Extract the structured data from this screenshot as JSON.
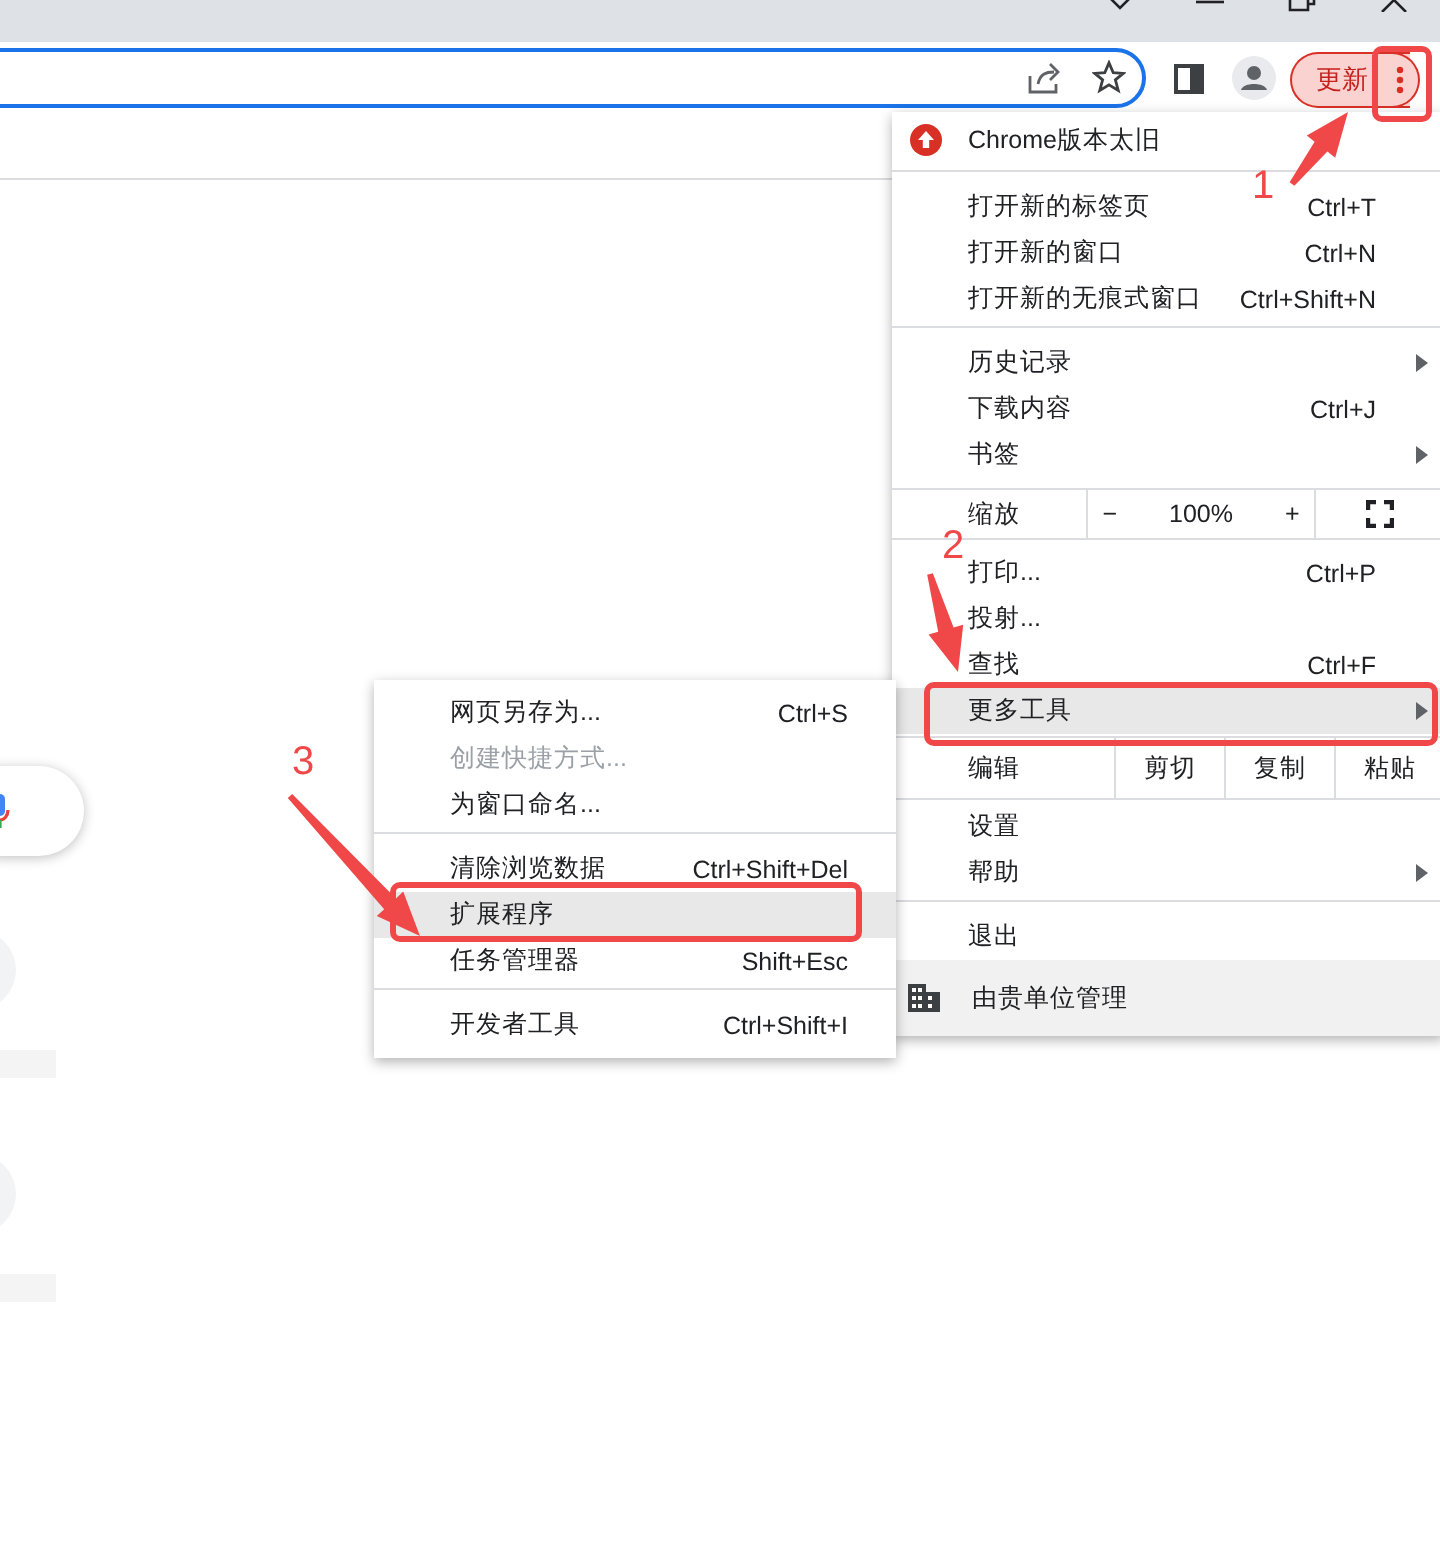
{
  "toolbar": {
    "update_button": "更新"
  },
  "menu": {
    "items": [
      {
        "kind": "header",
        "label": "Chrome版本太旧"
      },
      {
        "kind": "separator"
      },
      {
        "kind": "item",
        "label": "打开新的标签页",
        "shortcut": "Ctrl+T",
        "submenu": false,
        "selected": false
      },
      {
        "kind": "item",
        "label": "打开新的窗口",
        "shortcut": "Ctrl+N",
        "submenu": false,
        "selected": false
      },
      {
        "kind": "item",
        "label": "打开新的无痕式窗口",
        "shortcut": "Ctrl+Shift+N",
        "submenu": false,
        "selected": false
      },
      {
        "kind": "separator"
      },
      {
        "kind": "item",
        "label": "历史记录",
        "submenu": true,
        "selected": false
      },
      {
        "kind": "item",
        "label": "下载内容",
        "shortcut": "Ctrl+J",
        "submenu": false,
        "selected": false
      },
      {
        "kind": "item",
        "label": "书签",
        "submenu": true,
        "selected": false
      },
      {
        "kind": "zoom",
        "label": "缩放",
        "minus": "−",
        "value": "100%",
        "plus": "+"
      },
      {
        "kind": "item",
        "label": "打印...",
        "shortcut": "Ctrl+P",
        "submenu": false,
        "selected": false
      },
      {
        "kind": "item",
        "label": "投射...",
        "submenu": false,
        "selected": false
      },
      {
        "kind": "item",
        "label": "查找",
        "shortcut": "Ctrl+F",
        "submenu": false,
        "selected": false
      },
      {
        "kind": "item",
        "label": "更多工具",
        "submenu": true,
        "selected": true
      },
      {
        "kind": "edit",
        "label": "编辑",
        "actions": [
          "剪切",
          "复制",
          "粘贴"
        ]
      },
      {
        "kind": "item",
        "label": "设置",
        "submenu": false,
        "selected": false
      },
      {
        "kind": "item",
        "label": "帮助",
        "submenu": true,
        "selected": false
      },
      {
        "kind": "separator"
      },
      {
        "kind": "item",
        "label": "退出",
        "submenu": false,
        "selected": false
      },
      {
        "kind": "managed",
        "label": "由贵单位管理"
      }
    ]
  },
  "submenu": {
    "items": [
      {
        "kind": "item",
        "label": "网页另存为...",
        "shortcut": "Ctrl+S",
        "disabled": false,
        "selected": false
      },
      {
        "kind": "item",
        "label": "创建快捷方式...",
        "disabled": true,
        "selected": false
      },
      {
        "kind": "item",
        "label": "为窗口命名...",
        "disabled": false,
        "selected": false
      },
      {
        "kind": "separator"
      },
      {
        "kind": "item",
        "label": "清除浏览数据",
        "shortcut": "Ctrl+Shift+Del",
        "disabled": false,
        "selected": false
      },
      {
        "kind": "item",
        "label": "扩展程序",
        "disabled": false,
        "selected": true
      },
      {
        "kind": "item",
        "label": "任务管理器",
        "shortcut": "Shift+Esc",
        "disabled": false,
        "selected": false
      },
      {
        "kind": "separator"
      },
      {
        "kind": "item",
        "label": "开发者工具",
        "shortcut": "Ctrl+Shift+I",
        "disabled": false,
        "selected": false
      }
    ]
  },
  "annotations": [
    {
      "number": "1"
    },
    {
      "number": "2"
    },
    {
      "number": "3"
    }
  ]
}
